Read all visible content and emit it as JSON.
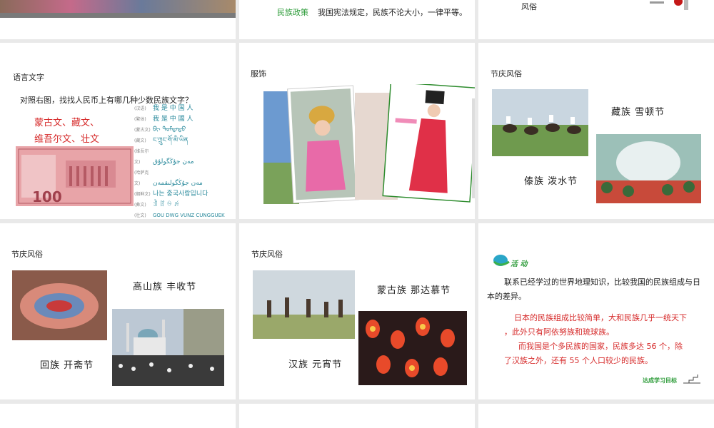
{
  "slides": {
    "s1": {},
    "s2": {
      "policy_label": "民族政策",
      "policy_text": "我国宪法规定，民族不论大小，一律平等。"
    },
    "s3": {
      "title": "风俗"
    },
    "s4": {
      "title": "语言文字",
      "question": "对照右图，找找人民币上有哪几种少数民族文字？",
      "answer1": "蒙古文、藏文、",
      "answer2": "维吾尔文、壮文",
      "banknote_value": "100",
      "script_lines": [
        "我 是 中 国 人",
        "我 是 中 國 人",
        "ᠪᠢ ᠳᠤᠮᠳᠠᠳᠤ",
        "ང་ཀྲུང་གོ་མི་ཡིན",
        "مەن جۇڭگولۇق",
        "مەن جۇڭگولىقمەن",
        "나는 중국사람입니다",
        "ꀉ ꍏ ꍈ ꉌ",
        "GOU DWG VUNZ CUNGGUEK"
      ],
      "script_labels": [
        "(汉语)",
        "(繁体)",
        "(蒙古文)",
        "(藏文)",
        "(维吾尔文)",
        "(哈萨克文)",
        "(朝鲜文)",
        "(彝文)",
        "(壮文)"
      ]
    },
    "s5": {
      "title": "服饰"
    },
    "s6": {
      "title": "节庆风俗",
      "caption1": "藏族  雪顿节",
      "caption2": "傣族  泼水节"
    },
    "s7": {
      "title": "节庆风俗",
      "caption1": "高山族  丰收节",
      "caption2": "回族  开斋节"
    },
    "s8": {
      "title": "节庆风俗",
      "caption1": "蒙古族  那达慕节",
      "caption2": "汉族  元宵节"
    },
    "s9": {
      "activity_label": "活 动",
      "text1": "联系已经学过的世界地理知识，比较我国的民族组成与日",
      "text2": "本的差异。",
      "red1": "日本的民族组成比较简单，大和民族几乎一统天下",
      "red2": "，此外只有阿依努族和琉球族。",
      "red3": "而我国是个多民族的国家，民族多达 56 个，除",
      "red4": "了汉族之外，还有 55 个人口较少的民族。",
      "footer": "达成学习目标"
    }
  },
  "colors": {
    "green": "#2e9c3a",
    "red": "#d62a2a",
    "teal": "#2a8a9c"
  }
}
